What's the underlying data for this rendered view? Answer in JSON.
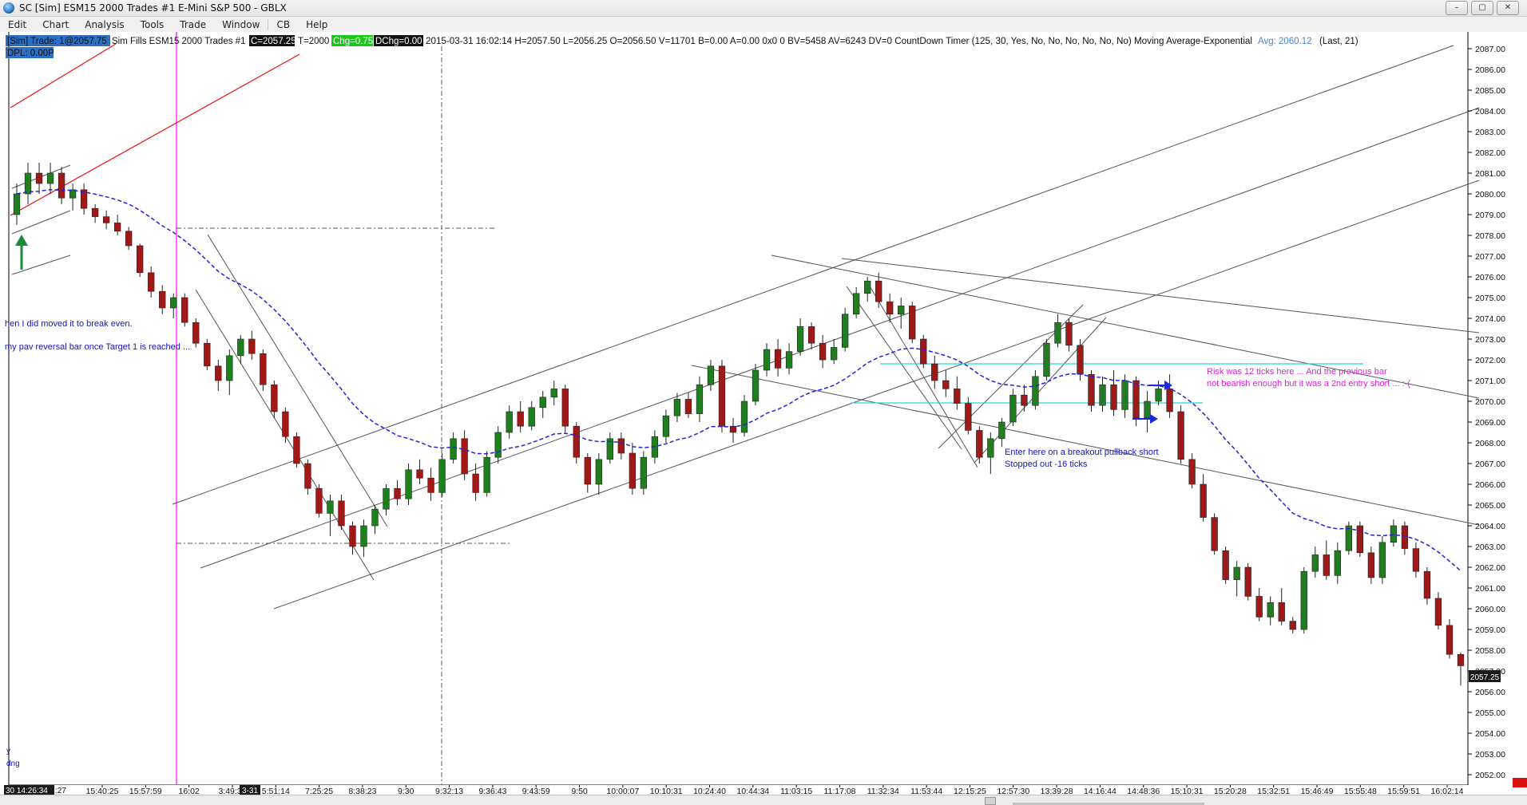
{
  "window": {
    "title": "SC [Sim] ESM15  2000 Trades  #1  E-Mini S&P 500 - GBLX",
    "minimize_label": "–",
    "maximize_label": "▢",
    "close_label": "✕"
  },
  "menu": [
    "Edit",
    "Chart",
    "Analysis",
    "Tools",
    "Trade",
    "Window",
    "CB",
    "Help"
  ],
  "info_line": {
    "sim_trade": "[Sim]  Trade: 1@2057.75",
    "symbol_desc": "Sim Fills  ESM15  2000 Trades  #1",
    "close_label": "C=2057.25",
    "trades_label": "T=2000",
    "chg_label": "Chg=0.75",
    "dchg_label": "DChg=0.00",
    "bar_stats": "2015-03-31 16:02:14 H=2057.50 L=2056.25 O=2056.50 V=11701 B=0.00 A=0.00 0x0 0 BV=5458 AV=6243 DV=0 CountDown Timer  (125, 30, Yes, No, No, No, No, No, No)  Moving Average-Exponential",
    "avg_label": "Avg: 2060.12",
    "ma_params": "(Last, 21)",
    "dpl_label": "DPL: 0.00P"
  },
  "price_axis": {
    "ticks": [
      "2087.00",
      "2086.00",
      "2085.00",
      "2084.00",
      "2083.00",
      "2082.00",
      "2081.00",
      "2080.00",
      "2079.00",
      "2078.00",
      "2077.00",
      "2076.00",
      "2075.00",
      "2074.00",
      "2073.00",
      "2072.00",
      "2071.00",
      "2070.00",
      "2069.00",
      "2068.00",
      "2067.00",
      "2066.00",
      "2065.00",
      "2064.00",
      "2063.00",
      "2062.00",
      "2061.00",
      "2060.00",
      "2059.00",
      "2058.00",
      "2057.00",
      "2056.00",
      "2055.00",
      "2054.00",
      "2053.00",
      "2052.00"
    ],
    "current_price_label": "2057.25"
  },
  "time_axis": {
    "labels": [
      "15:40:25",
      "15:57:59",
      "16:02",
      "3:49:38",
      "5:51:14",
      "7:25:25",
      "8:38:23",
      "9:30",
      "9:32:13",
      "9:36:43",
      "9:43:59",
      "9:50",
      "10:00:07",
      "10:10:31",
      "10:24:40",
      "10:44:34",
      "11:03:15",
      "11:17:08",
      "11:32:34",
      "11:53:44",
      "12:15:25",
      "12:57:30",
      "13:39:28",
      "14:16:44",
      "14:48:36",
      "15:10:31",
      "15:20:28",
      "15:32:51",
      "15:46:49",
      "15:55:48",
      "15:59:51",
      "16:02:14"
    ],
    "left_date_label": "30 14:26:34",
    "left_date_trail": ":27",
    "day_marker": "3-31"
  },
  "annotations": {
    "note1": "hen I did moved it to break even.",
    "note2": "my pav reversal bar once Target 1 is reached ...",
    "entry_note_line1": "Enter here on a breakout pullback short",
    "entry_note_line2": "Stopped out -16 ticks",
    "risk_note_line1": "Risk was 12 ticks here ...  And the previous bar",
    "risk_note_line2": "not bearish enough but it was a 2nd entry short ... :-(",
    "left_small_1": "y",
    "left_small_2": "dng"
  },
  "colors": {
    "up_bar": "#1f7f1f",
    "down_bar": "#a01818",
    "moving_average": "#2222dd",
    "magenta_line": "#ff00ff",
    "cyan_line": "#22d6e6",
    "annotation_blue": "#1414c8",
    "annotation_magenta": "#e020d8",
    "chg_bg": "#19c819"
  },
  "chart_data": {
    "type": "candlestick",
    "symbol": "ESM15",
    "bar_period": "2000 Trades",
    "ylim": [
      2051.5,
      2087.5
    ],
    "moving_average": {
      "type": "exponential",
      "length": 21,
      "last": 2060.12
    },
    "bars": [
      [
        2079,
        2080.5,
        2078.5,
        2080
      ],
      [
        2080,
        2081.5,
        2079.5,
        2081
      ],
      [
        2081,
        2081.5,
        2080,
        2080.5
      ],
      [
        2080.5,
        2081.5,
        2080,
        2081
      ],
      [
        2081,
        2081.3,
        2079.5,
        2079.8
      ],
      [
        2079.8,
        2080.5,
        2079.2,
        2080.2
      ],
      [
        2080.2,
        2080.5,
        2079,
        2079.3
      ],
      [
        2079.3,
        2079.5,
        2078.6,
        2078.9
      ],
      [
        2078.9,
        2079.2,
        2078.3,
        2078.6
      ],
      [
        2078.6,
        2079,
        2078,
        2078.2
      ],
      [
        2078.2,
        2078.4,
        2077.3,
        2077.5
      ],
      [
        2077.5,
        2077.6,
        2076,
        2076.2
      ],
      [
        2076.2,
        2076.5,
        2075,
        2075.3
      ],
      [
        2075.3,
        2075.6,
        2074.2,
        2074.5
      ],
      [
        2074.5,
        2075.2,
        2074,
        2075
      ],
      [
        2075,
        2075.2,
        2073.6,
        2073.8
      ],
      [
        2073.8,
        2074,
        2072.6,
        2072.8
      ],
      [
        2072.8,
        2073,
        2071.5,
        2071.7
      ],
      [
        2071.7,
        2072,
        2070.5,
        2071
      ],
      [
        2071,
        2072.5,
        2070.3,
        2072.2
      ],
      [
        2072.2,
        2073.2,
        2071.8,
        2073
      ],
      [
        2073,
        2073.4,
        2072,
        2072.3
      ],
      [
        2072.3,
        2072.5,
        2070.5,
        2070.8
      ],
      [
        2070.8,
        2071,
        2069.2,
        2069.5
      ],
      [
        2069.5,
        2069.7,
        2068,
        2068.3
      ],
      [
        2068.3,
        2068.5,
        2066.8,
        2067
      ],
      [
        2067,
        2067.2,
        2065.5,
        2065.8
      ],
      [
        2065.8,
        2066,
        2064.4,
        2064.6
      ],
      [
        2064.6,
        2065.5,
        2063.5,
        2065.2
      ],
      [
        2065.2,
        2065.5,
        2063.8,
        2064
      ],
      [
        2064,
        2064.2,
        2062.6,
        2063
      ],
      [
        2063,
        2064.3,
        2062.5,
        2064
      ],
      [
        2064,
        2065,
        2063.6,
        2064.8
      ],
      [
        2064.8,
        2066,
        2064.5,
        2065.8
      ],
      [
        2065.8,
        2066.2,
        2065,
        2065.3
      ],
      [
        2065.3,
        2067,
        2065,
        2066.7
      ],
      [
        2066.7,
        2067.2,
        2066,
        2066.3
      ],
      [
        2066.3,
        2066.8,
        2065.2,
        2065.6
      ],
      [
        2065.6,
        2067.5,
        2065.4,
        2067.2
      ],
      [
        2067.2,
        2068.5,
        2067,
        2068.2
      ],
      [
        2068.2,
        2068.6,
        2066.2,
        2066.5
      ],
      [
        2066.5,
        2067,
        2065.2,
        2065.6
      ],
      [
        2065.6,
        2067.6,
        2065.4,
        2067.3
      ],
      [
        2067.3,
        2068.8,
        2067,
        2068.5
      ],
      [
        2068.5,
        2069.8,
        2068.2,
        2069.5
      ],
      [
        2069.5,
        2070,
        2068.5,
        2068.8
      ],
      [
        2068.8,
        2070,
        2068.6,
        2069.7
      ],
      [
        2069.7,
        2070.5,
        2069.2,
        2070.2
      ],
      [
        2070.2,
        2071,
        2069.8,
        2070.6
      ],
      [
        2070.6,
        2070.8,
        2068.5,
        2068.8
      ],
      [
        2068.8,
        2069,
        2067,
        2067.3
      ],
      [
        2067.3,
        2067.5,
        2065.6,
        2066
      ],
      [
        2066,
        2067.5,
        2065.5,
        2067.2
      ],
      [
        2067.2,
        2068.5,
        2067,
        2068.2
      ],
      [
        2068.2,
        2068.5,
        2067.2,
        2067.5
      ],
      [
        2067.5,
        2068,
        2065.5,
        2065.8
      ],
      [
        2065.8,
        2067.6,
        2065.5,
        2067.3
      ],
      [
        2067.3,
        2068.6,
        2067,
        2068.3
      ],
      [
        2068.3,
        2069.6,
        2068,
        2069.3
      ],
      [
        2069.3,
        2070.4,
        2069,
        2070.1
      ],
      [
        2070.1,
        2070.4,
        2069.2,
        2069.4
      ],
      [
        2069.4,
        2071.2,
        2069,
        2070.8
      ],
      [
        2070.8,
        2072,
        2070.5,
        2071.7
      ],
      [
        2071.7,
        2072,
        2068.5,
        2068.8
      ],
      [
        2068.8,
        2069.2,
        2068,
        2068.5
      ],
      [
        2068.5,
        2070.3,
        2068.3,
        2070
      ],
      [
        2070,
        2071.8,
        2069.8,
        2071.5
      ],
      [
        2071.5,
        2072.8,
        2071.2,
        2072.5
      ],
      [
        2072.5,
        2073,
        2071.2,
        2071.6
      ],
      [
        2071.6,
        2072.8,
        2071.3,
        2072.4
      ],
      [
        2072.4,
        2074,
        2072.2,
        2073.6
      ],
      [
        2073.6,
        2073.8,
        2072.5,
        2072.8
      ],
      [
        2072.8,
        2073.2,
        2071.6,
        2072
      ],
      [
        2072,
        2073,
        2071.8,
        2072.6
      ],
      [
        2072.6,
        2074.5,
        2072.4,
        2074.2
      ],
      [
        2074.2,
        2075.5,
        2074,
        2075.2
      ],
      [
        2075.2,
        2076,
        2074.8,
        2075.8
      ],
      [
        2075.8,
        2076.2,
        2074.5,
        2074.8
      ],
      [
        2074.8,
        2075.2,
        2073.8,
        2074.2
      ],
      [
        2074.2,
        2075,
        2073.5,
        2074.6
      ],
      [
        2074.6,
        2074.8,
        2072.8,
        2073
      ],
      [
        2073,
        2073.2,
        2071.6,
        2071.8
      ],
      [
        2071.8,
        2072.2,
        2070.6,
        2071
      ],
      [
        2071,
        2071.5,
        2070.2,
        2070.6
      ],
      [
        2070.6,
        2071.2,
        2069.6,
        2069.9
      ],
      [
        2069.9,
        2070.2,
        2068.4,
        2068.6
      ],
      [
        2068.6,
        2068.8,
        2067,
        2067.3
      ],
      [
        2067.3,
        2068.5,
        2066.5,
        2068.2
      ],
      [
        2068.2,
        2069.2,
        2067.8,
        2069
      ],
      [
        2069,
        2070.6,
        2068.8,
        2070.3
      ],
      [
        2070.3,
        2070.8,
        2069.5,
        2069.8
      ],
      [
        2069.8,
        2071.5,
        2069.6,
        2071.2
      ],
      [
        2071.2,
        2073,
        2071,
        2072.8
      ],
      [
        2072.8,
        2074.2,
        2072.6,
        2073.8
      ],
      [
        2073.8,
        2074,
        2072.4,
        2072.7
      ],
      [
        2072.7,
        2073,
        2071,
        2071.3
      ],
      [
        2071.3,
        2071.5,
        2069.5,
        2069.8
      ],
      [
        2069.8,
        2071.2,
        2069.5,
        2070.8
      ],
      [
        2070.8,
        2071.5,
        2069.3,
        2069.6
      ],
      [
        2069.6,
        2071.3,
        2069.2,
        2071
      ],
      [
        2071,
        2071.2,
        2068.8,
        2069.2
      ],
      [
        2069.2,
        2070.5,
        2068.5,
        2070
      ],
      [
        2070,
        2071,
        2069.8,
        2070.6
      ],
      [
        2070.6,
        2071.3,
        2069.2,
        2069.5
      ],
      [
        2069.5,
        2069.8,
        2067,
        2067.2
      ],
      [
        2067.2,
        2067.5,
        2065.8,
        2066
      ],
      [
        2066,
        2066.5,
        2064.2,
        2064.4
      ],
      [
        2064.4,
        2064.6,
        2062.6,
        2062.8
      ],
      [
        2062.8,
        2063,
        2061.2,
        2061.4
      ],
      [
        2061.4,
        2062.3,
        2060.6,
        2062
      ],
      [
        2062,
        2062.2,
        2060.4,
        2060.6
      ],
      [
        2060.6,
        2061,
        2059.4,
        2059.6
      ],
      [
        2059.6,
        2060.6,
        2059.2,
        2060.3
      ],
      [
        2060.3,
        2061,
        2059.2,
        2059.4
      ],
      [
        2059.4,
        2059.6,
        2058.8,
        2059
      ],
      [
        2059,
        2062,
        2058.8,
        2061.8
      ],
      [
        2061.8,
        2063,
        2061.5,
        2062.6
      ],
      [
        2062.6,
        2063.3,
        2061.4,
        2061.6
      ],
      [
        2061.6,
        2063.2,
        2061.2,
        2062.8
      ],
      [
        2062.8,
        2064.2,
        2062.6,
        2064
      ],
      [
        2064,
        2064.2,
        2062.5,
        2062.7
      ],
      [
        2062.7,
        2063,
        2061.2,
        2061.5
      ],
      [
        2061.5,
        2063.5,
        2061.2,
        2063.2
      ],
      [
        2063.2,
        2064.3,
        2063,
        2064
      ],
      [
        2064,
        2064.2,
        2062.6,
        2062.9
      ],
      [
        2062.9,
        2063.2,
        2061.5,
        2061.8
      ],
      [
        2061.8,
        2062,
        2060.2,
        2060.5
      ],
      [
        2060.5,
        2060.8,
        2059,
        2059.2
      ],
      [
        2059.2,
        2059.5,
        2057.6,
        2057.8
      ],
      [
        2057.8,
        2057.9,
        2056.3,
        2057.25
      ]
    ]
  }
}
